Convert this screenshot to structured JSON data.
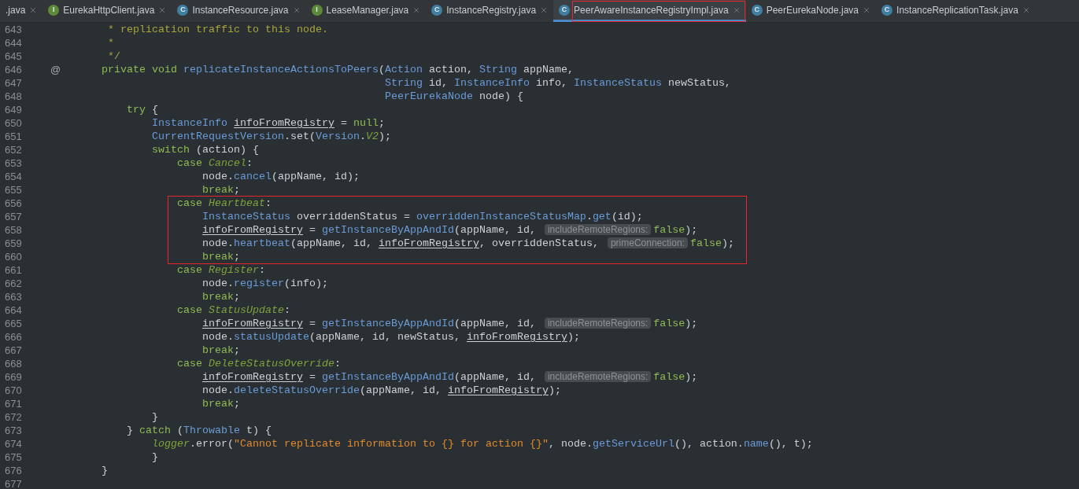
{
  "tabs": [
    {
      "label": ".java",
      "kind": "plain",
      "selected": false
    },
    {
      "label": "EurekaHttpClient.java",
      "icon": "I",
      "kind": "interface",
      "selected": false
    },
    {
      "label": "InstanceResource.java",
      "icon": "C",
      "kind": "class",
      "selected": false
    },
    {
      "label": "LeaseManager.java",
      "icon": "I",
      "kind": "interface",
      "selected": false
    },
    {
      "label": "InstanceRegistry.java",
      "icon": "C",
      "kind": "class",
      "selected": false
    },
    {
      "label": "PeerAwareInstanceRegistryImpl.java",
      "icon": "C",
      "kind": "class",
      "selected": true,
      "boxed": true
    },
    {
      "label": "PeerEurekaNode.java",
      "icon": "C",
      "kind": "class",
      "selected": false
    },
    {
      "label": "InstanceReplicationTask.java",
      "icon": "C",
      "kind": "class",
      "selected": false
    }
  ],
  "lines": [
    {
      "number": "643",
      "tokens": [
        {
          "kind": "comment",
          "text": "     * replication traffic to this node."
        }
      ]
    },
    {
      "number": "644",
      "tokens": [
        {
          "kind": "comment",
          "text": "     *"
        }
      ]
    },
    {
      "number": "645",
      "tokens": [
        {
          "kind": "comment",
          "text": "     */"
        }
      ]
    },
    {
      "number": "646",
      "marker": "@",
      "tokens": [
        {
          "kind": "keyword",
          "text": "    private void "
        },
        {
          "kind": "type",
          "text": "replicateInstanceActionsToPeers"
        },
        {
          "kind": "plain",
          "text": "("
        },
        {
          "kind": "type",
          "text": "Action"
        },
        {
          "kind": "plain",
          "text": " action, "
        },
        {
          "kind": "type",
          "text": "String"
        },
        {
          "kind": "plain",
          "text": " appName,"
        }
      ]
    },
    {
      "number": "647",
      "tokens": [
        {
          "kind": "type",
          "text": "                                                 String"
        },
        {
          "kind": "plain",
          "text": " id, "
        },
        {
          "kind": "type",
          "text": "InstanceInfo"
        },
        {
          "kind": "plain",
          "text": " info, "
        },
        {
          "kind": "type",
          "text": "InstanceStatus"
        },
        {
          "kind": "plain",
          "text": " newStatus,"
        }
      ]
    },
    {
      "number": "648",
      "tokens": [
        {
          "kind": "type",
          "text": "                                                 PeerEurekaNode"
        },
        {
          "kind": "plain",
          "text": " node) {"
        }
      ]
    },
    {
      "number": "649",
      "tokens": [
        {
          "kind": "keyword",
          "text": "        try"
        },
        {
          "kind": "plain",
          "text": " {"
        }
      ]
    },
    {
      "number": "650",
      "tokens": [
        {
          "kind": "type",
          "text": "            InstanceInfo"
        },
        {
          "kind": "var",
          "text": " infoFromRegistry"
        },
        {
          "kind": "plain",
          "text": " = "
        },
        {
          "kind": "keyword",
          "text": "null"
        },
        {
          "kind": "plain",
          "text": ";"
        }
      ]
    },
    {
      "number": "651",
      "tokens": [
        {
          "kind": "type",
          "text": "            CurrentRequestVersion"
        },
        {
          "kind": "plain",
          "text": ".set("
        },
        {
          "kind": "type",
          "text": "Version"
        },
        {
          "kind": "plain",
          "text": "."
        },
        {
          "kind": "constant",
          "text": "V2"
        },
        {
          "kind": "plain",
          "text": ");"
        }
      ]
    },
    {
      "number": "652",
      "tokens": [
        {
          "kind": "keyword",
          "text": "            switch"
        },
        {
          "kind": "plain",
          "text": " (action) {"
        }
      ]
    },
    {
      "number": "653",
      "tokens": [
        {
          "kind": "keyword",
          "text": "                case "
        },
        {
          "kind": "constant",
          "text": "Cancel"
        },
        {
          "kind": "plain",
          "text": ":"
        }
      ]
    },
    {
      "number": "654",
      "tokens": [
        {
          "kind": "plain",
          "text": "                    node."
        },
        {
          "kind": "type",
          "text": "cancel"
        },
        {
          "kind": "plain",
          "text": "(appName, id);"
        }
      ]
    },
    {
      "number": "655",
      "tokens": [
        {
          "kind": "keyword",
          "text": "                    break"
        },
        {
          "kind": "plain",
          "text": ";"
        }
      ]
    },
    {
      "number": "656",
      "boxed": true,
      "tokens": [
        {
          "kind": "keyword",
          "text": "                case "
        },
        {
          "kind": "constant",
          "text": "Heartbeat"
        },
        {
          "kind": "plain",
          "text": ":"
        }
      ]
    },
    {
      "number": "657",
      "boxed": true,
      "tokens": [
        {
          "kind": "type",
          "text": "                    InstanceStatus"
        },
        {
          "kind": "plain",
          "text": " overriddenStatus = "
        },
        {
          "kind": "type",
          "text": "overriddenInstanceStatusMap"
        },
        {
          "kind": "plain",
          "text": "."
        },
        {
          "kind": "type",
          "text": "get"
        },
        {
          "kind": "plain",
          "text": "(id);"
        }
      ]
    },
    {
      "number": "658",
      "boxed": true,
      "tokens": [
        {
          "kind": "var",
          "text": "                    infoFromRegistry"
        },
        {
          "kind": "plain",
          "text": " = "
        },
        {
          "kind": "type",
          "text": "getInstanceByAppAndId"
        },
        {
          "kind": "plain",
          "text": "(appName, id, "
        },
        {
          "kind": "hint",
          "text": "includeRemoteRegions:"
        },
        {
          "kind": "keyword",
          "text": "false"
        },
        {
          "kind": "plain",
          "text": ");"
        }
      ]
    },
    {
      "number": "659",
      "boxed": true,
      "tokens": [
        {
          "kind": "plain",
          "text": "                    node."
        },
        {
          "kind": "type",
          "text": "heartbeat"
        },
        {
          "kind": "plain",
          "text": "(appName, id, "
        },
        {
          "kind": "var",
          "text": "infoFromRegistry"
        },
        {
          "kind": "plain",
          "text": ", overriddenStatus, "
        },
        {
          "kind": "hint",
          "text": "primeConnection:"
        },
        {
          "kind": "keyword",
          "text": "false"
        },
        {
          "kind": "plain",
          "text": ");"
        }
      ]
    },
    {
      "number": "660",
      "boxed": true,
      "tokens": [
        {
          "kind": "keyword",
          "text": "                    break"
        },
        {
          "kind": "plain",
          "text": ";"
        }
      ]
    },
    {
      "number": "661",
      "tokens": [
        {
          "kind": "keyword",
          "text": "                case "
        },
        {
          "kind": "constant",
          "text": "Register"
        },
        {
          "kind": "plain",
          "text": ":"
        }
      ]
    },
    {
      "number": "662",
      "tokens": [
        {
          "kind": "plain",
          "text": "                    node."
        },
        {
          "kind": "type",
          "text": "register"
        },
        {
          "kind": "plain",
          "text": "(info);"
        }
      ]
    },
    {
      "number": "663",
      "tokens": [
        {
          "kind": "keyword",
          "text": "                    break"
        },
        {
          "kind": "plain",
          "text": ";"
        }
      ]
    },
    {
      "number": "664",
      "tokens": [
        {
          "kind": "keyword",
          "text": "                case "
        },
        {
          "kind": "constant",
          "text": "StatusUpdate"
        },
        {
          "kind": "plain",
          "text": ":"
        }
      ]
    },
    {
      "number": "665",
      "tokens": [
        {
          "kind": "var",
          "text": "                    infoFromRegistry"
        },
        {
          "kind": "plain",
          "text": " = "
        },
        {
          "kind": "type",
          "text": "getInstanceByAppAndId"
        },
        {
          "kind": "plain",
          "text": "(appName, id, "
        },
        {
          "kind": "hint",
          "text": "includeRemoteRegions:"
        },
        {
          "kind": "keyword",
          "text": "false"
        },
        {
          "kind": "plain",
          "text": ");"
        }
      ]
    },
    {
      "number": "666",
      "tokens": [
        {
          "kind": "plain",
          "text": "                    node."
        },
        {
          "kind": "type",
          "text": "statusUpdate"
        },
        {
          "kind": "plain",
          "text": "(appName, id, newStatus, "
        },
        {
          "kind": "var",
          "text": "infoFromRegistry"
        },
        {
          "kind": "plain",
          "text": ");"
        }
      ]
    },
    {
      "number": "667",
      "tokens": [
        {
          "kind": "keyword",
          "text": "                    break"
        },
        {
          "kind": "plain",
          "text": ";"
        }
      ]
    },
    {
      "number": "668",
      "tokens": [
        {
          "kind": "keyword",
          "text": "                case "
        },
        {
          "kind": "constant",
          "text": "DeleteStatusOverride"
        },
        {
          "kind": "plain",
          "text": ":"
        }
      ]
    },
    {
      "number": "669",
      "tokens": [
        {
          "kind": "var",
          "text": "                    infoFromRegistry"
        },
        {
          "kind": "plain",
          "text": " = "
        },
        {
          "kind": "type",
          "text": "getInstanceByAppAndId"
        },
        {
          "kind": "plain",
          "text": "(appName, id, "
        },
        {
          "kind": "hint",
          "text": "includeRemoteRegions:"
        },
        {
          "kind": "keyword",
          "text": "false"
        },
        {
          "kind": "plain",
          "text": ");"
        }
      ]
    },
    {
      "number": "670",
      "tokens": [
        {
          "kind": "plain",
          "text": "                    node."
        },
        {
          "kind": "type",
          "text": "deleteStatusOverride"
        },
        {
          "kind": "plain",
          "text": "(appName, id, "
        },
        {
          "kind": "var",
          "text": "infoFromRegistry"
        },
        {
          "kind": "plain",
          "text": ");"
        }
      ]
    },
    {
      "number": "671",
      "tokens": [
        {
          "kind": "keyword",
          "text": "                    break"
        },
        {
          "kind": "plain",
          "text": ";"
        }
      ]
    },
    {
      "number": "672",
      "tokens": [
        {
          "kind": "plain",
          "text": "            }"
        }
      ]
    },
    {
      "number": "673",
      "tokens": [
        {
          "kind": "plain",
          "text": "        } "
        },
        {
          "kind": "keyword",
          "text": "catch"
        },
        {
          "kind": "plain",
          "text": " ("
        },
        {
          "kind": "type",
          "text": "Throwable"
        },
        {
          "kind": "plain",
          "text": " t) {"
        }
      ]
    },
    {
      "number": "674",
      "tokens": [
        {
          "kind": "constant",
          "text": "            logger"
        },
        {
          "kind": "plain",
          "text": ".error("
        },
        {
          "kind": "string",
          "text": "\"Cannot replicate information to {} for action {}\""
        },
        {
          "kind": "plain",
          "text": ", node."
        },
        {
          "kind": "type",
          "text": "getServiceUrl"
        },
        {
          "kind": "plain",
          "text": "(), action."
        },
        {
          "kind": "type",
          "text": "name"
        },
        {
          "kind": "plain",
          "text": "(), t);"
        }
      ]
    },
    {
      "number": "675",
      "tokens": [
        {
          "kind": "plain",
          "text": "            }"
        }
      ]
    },
    {
      "number": "676",
      "tokens": [
        {
          "kind": "plain",
          "text": "    }"
        }
      ]
    },
    {
      "number": "677"
    }
  ]
}
